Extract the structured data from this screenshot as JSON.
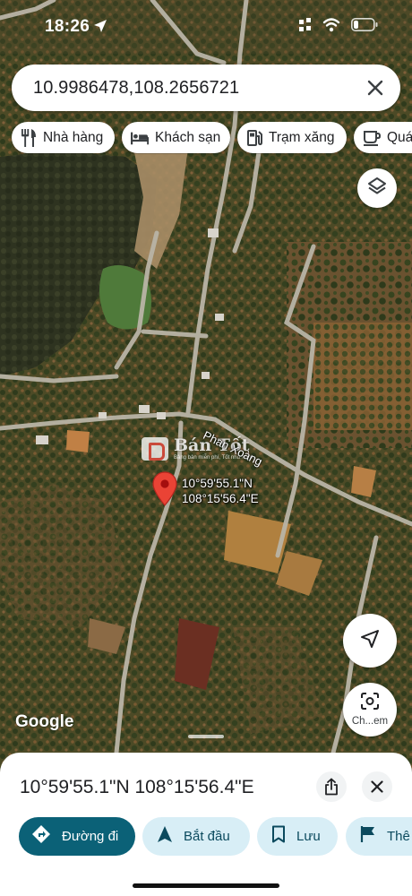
{
  "status_bar": {
    "time": "18:26",
    "icons": [
      "location-arrow-icon",
      "grid-icon",
      "wifi-icon",
      "battery-icon"
    ]
  },
  "search": {
    "query": "10.9986478,108.2656721",
    "clear_icon": "close-icon"
  },
  "categories": [
    {
      "label": "Nhà hàng",
      "icon": "restaurant-icon"
    },
    {
      "label": "Khách sạn",
      "icon": "hotel-icon"
    },
    {
      "label": "Trạm xăng",
      "icon": "gas-station-icon"
    },
    {
      "label": "Quán",
      "icon": "cafe-icon"
    }
  ],
  "map": {
    "road_label": "Phan Xoàng",
    "pin": {
      "lat": "10°59'55.1\"N",
      "lng": "108°15'56.4\"E"
    },
    "watermark": {
      "title": "Bán Tốt",
      "subtitle": "Bảng bản miễn phí, Tốt như mình"
    },
    "attribution": "Google",
    "lens_label": "Ch...em"
  },
  "place_sheet": {
    "title": "10°59'55.1\"N 108°15'56.4\"E",
    "actions": [
      {
        "label": "Đường đi",
        "icon": "directions-icon",
        "style": "primary"
      },
      {
        "label": "Bắt đầu",
        "icon": "navigation-icon",
        "style": "secondary"
      },
      {
        "label": "Lưu",
        "icon": "bookmark-icon",
        "style": "secondary"
      },
      {
        "label": "Thê",
        "icon": "flag-icon",
        "style": "secondary"
      }
    ]
  },
  "colors": {
    "pin_red": "#ea4335",
    "primary_button": "#0b6177",
    "secondary_button": "#d8eef6"
  }
}
